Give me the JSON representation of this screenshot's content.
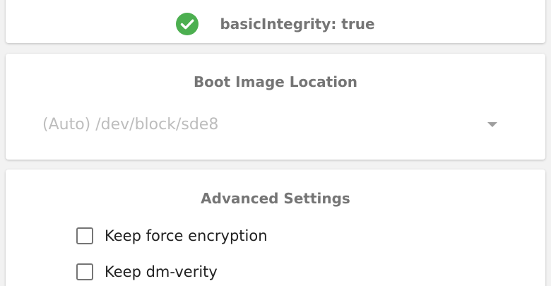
{
  "integrity": {
    "status_icon": "check-circle-icon",
    "status_color": "#4caf50",
    "text": "basicIntegrity: true"
  },
  "boot_image": {
    "title": "Boot Image Location",
    "selected": "(Auto) /dev/block/sde8"
  },
  "advanced": {
    "title": "Advanced Settings",
    "options": [
      {
        "label": "Keep force encryption",
        "checked": false
      },
      {
        "label": "Keep dm-verity",
        "checked": false
      }
    ]
  }
}
